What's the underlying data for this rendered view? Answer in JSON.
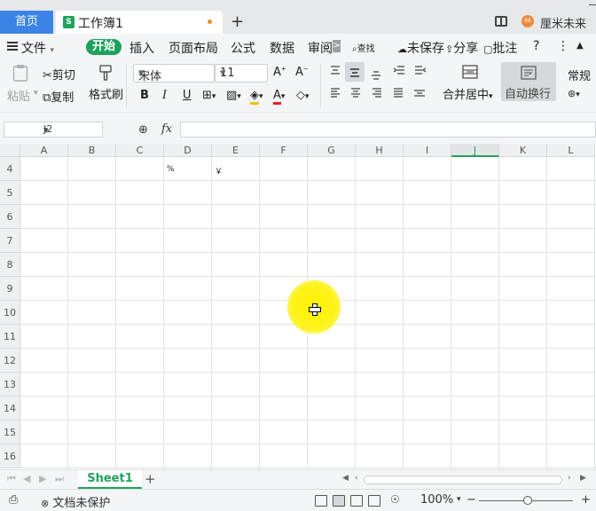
{
  "titlebar": {
    "home_tab": "首页",
    "doc_icon": "S",
    "doc_title": "工作簿1",
    "new_tab": "+",
    "user_badge": "88",
    "user_name": "厘米未来"
  },
  "menubar": {
    "file": "文件",
    "start": "开始",
    "insert": "插入",
    "page_layout": "页面布局",
    "formula": "公式",
    "data": "数据",
    "review": "审阅",
    "more": ">",
    "search": "查找",
    "unsaved": "未保存",
    "share": "分享",
    "comment": "批注",
    "help": "?"
  },
  "ribbon": {
    "paste": "粘贴",
    "cut": "剪切",
    "copy": "复制",
    "format_painter": "格式刷",
    "font_name": "宋体",
    "font_size": "11",
    "bold": "B",
    "italic": "I",
    "underline": "U",
    "merge_center": "合并居中",
    "auto_wrap": "自动换行",
    "number_format": "常规"
  },
  "formulabar": {
    "cell_ref": "J2",
    "fx": "fx"
  },
  "grid": {
    "columns": [
      "A",
      "B",
      "C",
      "D",
      "E",
      "F",
      "G",
      "H",
      "I",
      "J",
      "K",
      "L"
    ],
    "selected_column": "J",
    "rows": [
      "4",
      "5",
      "6",
      "7",
      "8",
      "9",
      "10",
      "11",
      "12",
      "13",
      "14",
      "15",
      "16"
    ],
    "cells": {
      "D4": "%",
      "E4": "￥"
    }
  },
  "sheetbar": {
    "sheet_name": "Sheet1",
    "add": "+"
  },
  "statusbar": {
    "protect": "文档未保护",
    "zoom": "100%",
    "zoom_out": "−",
    "zoom_in": "+"
  },
  "colors": {
    "accent_green": "#1ea35c",
    "home_tab_blue": "#3b84e6",
    "highlight_yellow": "#fff400"
  }
}
